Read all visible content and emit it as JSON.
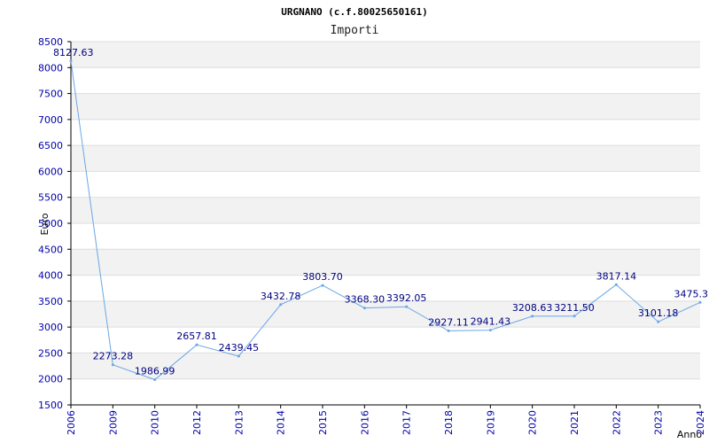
{
  "chart_data": {
    "type": "line",
    "title": "URGNANO (c.f.80025650161)",
    "subtitle": "Importi",
    "xlabel": "Anno",
    "ylabel": "Euro",
    "ylim": [
      1500,
      8500
    ],
    "ystep": 500,
    "grid": true,
    "categories": [
      "2006",
      "2009",
      "2010",
      "2012",
      "2013",
      "2014",
      "2015",
      "2016",
      "2017",
      "2018",
      "2019",
      "2020",
      "2021",
      "2022",
      "2023",
      "2024"
    ],
    "series": [
      {
        "values": [
          8127.63,
          2273.28,
          1986.99,
          2657.81,
          2439.45,
          3432.78,
          3803.7,
          3368.3,
          3392.05,
          2927.11,
          2941.43,
          3208.63,
          3211.5,
          3817.14,
          3101.18,
          3475.3
        ],
        "labels": [
          "8127.63",
          "2273.28",
          "1986.99",
          "2657.81",
          "2439.45",
          "3432.78",
          "3803.70",
          "3368.30",
          "3392.05",
          "2927.11",
          "2941.43",
          "3208.63",
          "3211.50",
          "3817.14",
          "3101.18",
          "3475.3"
        ]
      }
    ],
    "colors": {
      "line": "#6aa6e6",
      "band": "#f2f2f2",
      "grid": "#dddddd",
      "axis": "#000000"
    }
  }
}
